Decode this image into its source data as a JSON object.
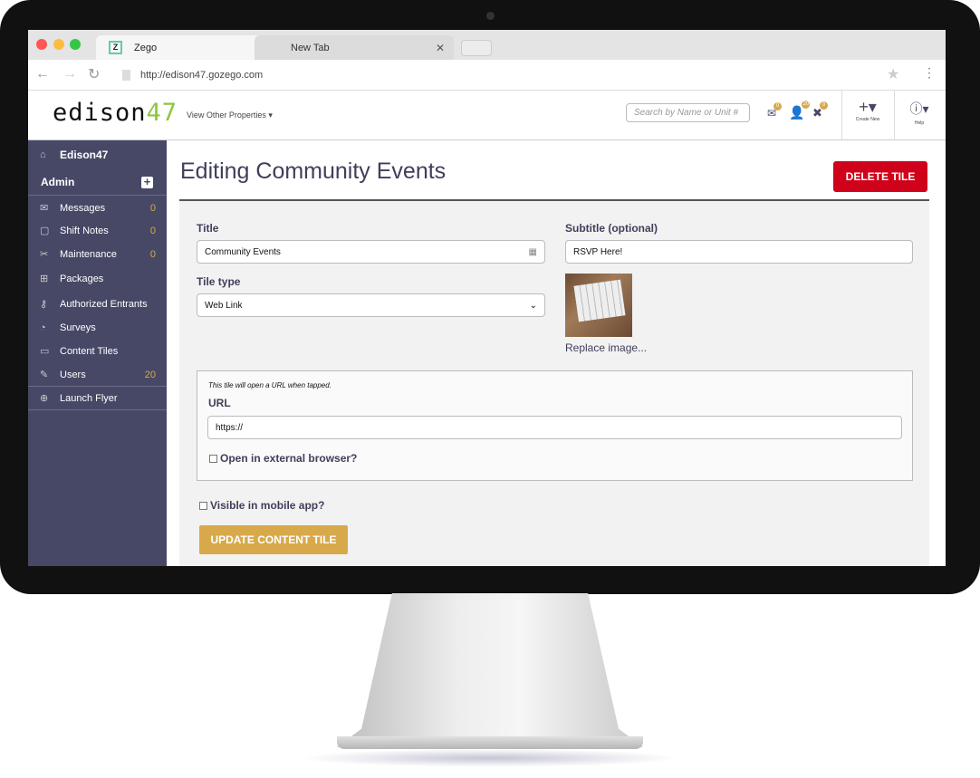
{
  "browser": {
    "tabs": [
      {
        "label": "Zego",
        "favicon": "Z"
      },
      {
        "label": "New Tab"
      }
    ],
    "url": "http://edison47.gozego.com"
  },
  "header": {
    "logo_main": "edison",
    "logo_num": "47",
    "properties_label": "View Other Properties",
    "search_placeholder": "Search by Name or Unit #",
    "badges": {
      "messages": "0",
      "users": "20",
      "maintenance": "0"
    },
    "create_label": "Create New",
    "help_label": "Help"
  },
  "sidebar": {
    "property": "Edison47",
    "section": "Admin",
    "items": [
      {
        "label": "Messages",
        "count": "0",
        "icon": "envelope-icon"
      },
      {
        "label": "Shift Notes",
        "count": "0",
        "icon": "note-icon"
      },
      {
        "label": "Maintenance",
        "count": "0",
        "icon": "tools-icon"
      },
      {
        "label": "Packages",
        "count": "",
        "icon": "package-icon"
      },
      {
        "label": "Authorized Entrants",
        "count": "",
        "icon": "key-icon"
      },
      {
        "label": "Surveys",
        "count": "",
        "icon": "pie-chart-icon"
      },
      {
        "label": "Content Tiles",
        "count": "",
        "icon": "tiles-icon"
      },
      {
        "label": "Users",
        "count": "20",
        "icon": "pencil-icon"
      }
    ],
    "launch": "Launch Flyer"
  },
  "page": {
    "title": "Editing Community Events",
    "delete_label": "DELETE TILE",
    "title_label": "Title",
    "title_value": "Community Events",
    "subtitle_label": "Subtitle (optional)",
    "subtitle_value": "RSVP Here!",
    "tile_type_label": "Tile type",
    "tile_type_value": "Web Link",
    "replace_image": "Replace image...",
    "hint": "This tile will open a URL when tapped.",
    "url_label": "URL",
    "url_value": "https://",
    "external_label": "Open in external browser?",
    "visible_label": "Visible in mobile app?",
    "update_label": "UPDATE CONTENT TILE"
  },
  "colors": {
    "sidebar": "#474866",
    "accent": "#d8a94a",
    "danger": "#d0021b"
  }
}
